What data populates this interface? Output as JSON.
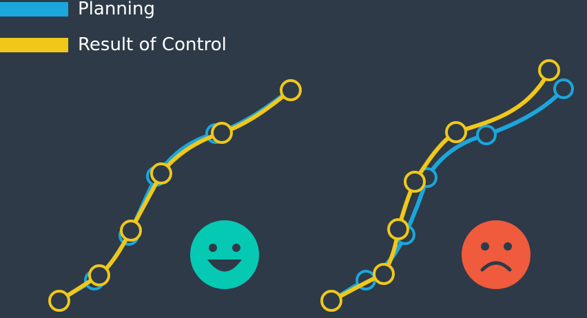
{
  "legend": [
    {
      "label": "Planning",
      "color": "#1ba6dc"
    },
    {
      "label": "Result of Control",
      "color": "#f0c819"
    }
  ],
  "colors": {
    "background": "#2e3a48",
    "happy_face": "#06c9b3",
    "sad_face": "#f05a3d",
    "face_features": "#2e3a48"
  },
  "icons": {
    "happy": "smiling-face-icon",
    "sad": "frowning-face-icon"
  }
}
